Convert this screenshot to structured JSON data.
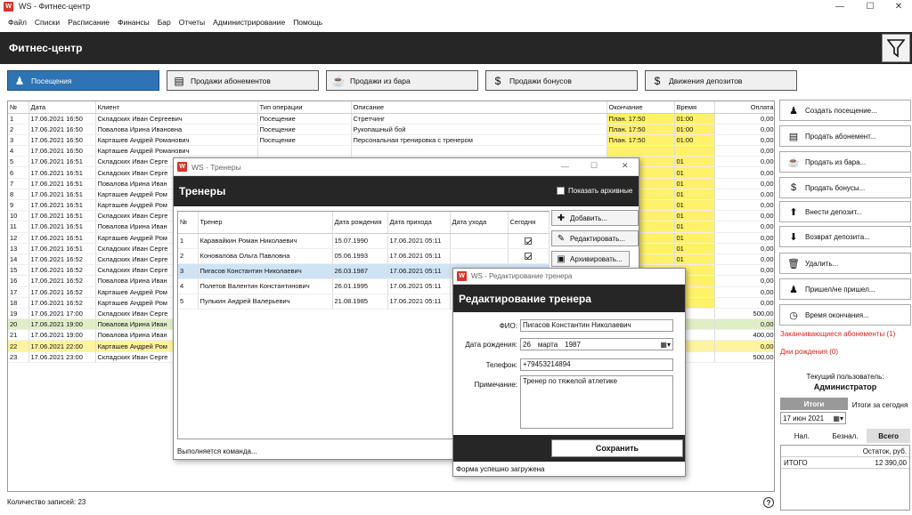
{
  "app": {
    "title": "WS - Фитнес-центр",
    "logo": "W"
  },
  "menu": [
    "Файл",
    "Списки",
    "Расписание",
    "Финансы",
    "Бар",
    "Отчеты",
    "Администрирование",
    "Помощь"
  ],
  "header": {
    "title": "Фитнес-центр"
  },
  "tabs": [
    {
      "label": "Посещения",
      "icon": "person-icon"
    },
    {
      "label": "Продажи абонементов",
      "icon": "card-icon"
    },
    {
      "label": "Продажи из бара",
      "icon": "cup-icon"
    },
    {
      "label": "Продажи бонусов",
      "icon": "dollar-icon"
    },
    {
      "label": "Движения депозитов",
      "icon": "dollar-icon"
    }
  ],
  "grid": {
    "columns": [
      "№",
      "Дата",
      "Клиент",
      "Тип операции",
      "Описание",
      "Окончание",
      "Время",
      "Оплата"
    ],
    "rows": [
      [
        "1",
        "17.06.2021 16:50",
        "Складских Иван Сергеевич",
        "Посещение",
        "Стретчинг",
        "План. 17:50",
        "01:00",
        "0,00"
      ],
      [
        "2",
        "17.06.2021 16:50",
        "Повалова Ирина Ивановна",
        "Посещение",
        "Рукопашный бой",
        "План. 17:50",
        "01:00",
        "0,00"
      ],
      [
        "3",
        "17.06.2021 16:50",
        "Карташев Андрей Романович",
        "Посещение",
        "Персональная тренировка с тренером",
        "План. 17:50",
        "01:00",
        "0,00"
      ],
      [
        "4",
        "17.06.2021 16:50",
        "Карташев Андрей Романович",
        "",
        "",
        "",
        "",
        "0,00"
      ],
      [
        "5",
        "17.06.2021 16:51",
        "Складских Иван Серге",
        "",
        "",
        "",
        "01",
        "0,00"
      ],
      [
        "6",
        "17.06.2021 16:51",
        "Складских Иван Серге",
        "",
        "",
        "",
        "01",
        "0,00"
      ],
      [
        "7",
        "17.06.2021 16:51",
        "Повалова Ирина Иван",
        "",
        "",
        "",
        "01",
        "0,00"
      ],
      [
        "8",
        "17.06.2021 16:51",
        "Карташев Андрей Ром",
        "",
        "",
        "",
        "01",
        "0,00"
      ],
      [
        "9",
        "17.06.2021 16:51",
        "Карташев Андрей Ром",
        "",
        "",
        "",
        "01",
        "0,00"
      ],
      [
        "10",
        "17.06.2021 16:51",
        "Складских Иван Серге",
        "",
        "",
        "",
        "01",
        "0,00"
      ],
      [
        "11",
        "17.06.2021 16:51",
        "Повалова Ирина Иван",
        "",
        "",
        "",
        "01",
        "0,00"
      ],
      [
        "12",
        "17.06.2021 16:51",
        "Карташев Андрей Ром",
        "",
        "",
        "",
        "01",
        "0,00"
      ],
      [
        "13",
        "17.06.2021 16:51",
        "Складских Иван Серге",
        "",
        "",
        "",
        "01",
        "0,00"
      ],
      [
        "14",
        "17.06.2021 16:52",
        "Складских Иван Серге",
        "",
        "",
        "",
        "01",
        "0,00"
      ],
      [
        "15",
        "17.06.2021 16:52",
        "Складских Иван Серге",
        "",
        "",
        "",
        "01",
        "0,00"
      ],
      [
        "16",
        "17.06.2021 16:52",
        "Повалова Ирина Иван",
        "",
        "",
        "",
        "01",
        "0,00"
      ],
      [
        "17",
        "17.06.2021 16:52",
        "Карташев Андрей Ром",
        "",
        "",
        "",
        "01",
        "0,00"
      ],
      [
        "18",
        "17.06.2021 16:52",
        "Карташев Андрей Ром",
        "",
        "",
        "",
        "01",
        "0,00"
      ],
      [
        "19",
        "17.06.2021 17:00",
        "Складских Иван Серге",
        "",
        "",
        "",
        "",
        "500,00"
      ],
      [
        "20",
        "17.06.2021 19:00",
        "Повалова Ирина Иван",
        "",
        "",
        "",
        "",
        "0,00"
      ],
      [
        "21",
        "17.06.2021 19:00",
        "Повалова Ирина Иван",
        "",
        "",
        "",
        "",
        "400,00"
      ],
      [
        "22",
        "17.06.2021 22:00",
        "Карташев Андрей Ром",
        "",
        "",
        "",
        "",
        "0,00"
      ],
      [
        "23",
        "17.06.2021 23:00",
        "Складских Иван Серге",
        "",
        "",
        "",
        "",
        "500,00"
      ]
    ]
  },
  "status": {
    "records": "Количество записей: 23"
  },
  "side": {
    "buttons": [
      {
        "label": "Создать посещение...",
        "icon": "person-icon"
      },
      {
        "label": "Продать абонемент...",
        "icon": "card-icon"
      },
      {
        "label": "Продать из бара...",
        "icon": "cup-icon"
      },
      {
        "label": "Продать бонусы...",
        "icon": "dollar-icon"
      },
      {
        "label": "Внести депозит...",
        "icon": "deposit-icon"
      },
      {
        "label": "Возврат депозита...",
        "icon": "refund-icon"
      },
      {
        "label": "Удалить...",
        "icon": "trash-icon"
      },
      {
        "label": "Пришел/не пришел...",
        "icon": "person-check-icon"
      },
      {
        "label": "Время окончания...",
        "icon": "clock-icon"
      }
    ],
    "expiring": "Заканчивающиеся абонементы (1)",
    "birthdays": "Дни рождения (0)",
    "user_label": "Текущий пользователь:",
    "user_name": "Администратор",
    "totals_btn": "Итоги",
    "totals_today": "Итоги за сегодня",
    "date": "17 июн 2021",
    "pay_tabs": [
      "Нал.",
      "Безнал.",
      "Всего"
    ],
    "balance_header": "Остаток, руб.",
    "total_label": "ИТОГО",
    "total_value": "12 390,00"
  },
  "trainers": {
    "title": "WS - Тренеры",
    "header": "Тренеры",
    "show_archive": "Показать архивные",
    "columns": [
      "№",
      "Тренер",
      "Дата рождения",
      "Дата прихода",
      "Дата ухода",
      "Сегодня"
    ],
    "rows": [
      [
        "1",
        "Каравайкин Роман Николаевич",
        "15.07.1990",
        "17.06.2021 05:11",
        "",
        true
      ],
      [
        "2",
        "Коновалова Ольга Павловна",
        "05.06.1993",
        "17.06.2021 05:11",
        "",
        true
      ],
      [
        "3",
        "Пигасов Константин Николаевич",
        "26.03.1987",
        "17.06.2021 05:11",
        "",
        false
      ],
      [
        "4",
        "Полетов Валентин Константинович",
        "26.01.1995",
        "17.06.2021 05:11",
        "",
        false
      ],
      [
        "5",
        "Пулькин Андрей Валерьевич",
        "21.08.1985",
        "17.06.2021 05:11",
        "",
        false
      ]
    ],
    "add": "Добавить...",
    "edit": "Редактировать...",
    "archive": "Архивировать...",
    "status": "Выполняется команда..."
  },
  "editor": {
    "title": "WS - Редактирование тренера",
    "header": "Редактирование тренера",
    "fio_label": "ФИО:",
    "fio": "Пигасов Константин Николаевич",
    "dob_label": "Дата рождения:",
    "dob_day": "26",
    "dob_month": "марта",
    "dob_year": "1987",
    "phone_label": "Телефон:",
    "phone": "+79453214894",
    "note_label": "Примечание:",
    "note": "Тренер по тяжелой атлетике",
    "save": "Сохранить",
    "status": "Форма успешно загружена"
  }
}
